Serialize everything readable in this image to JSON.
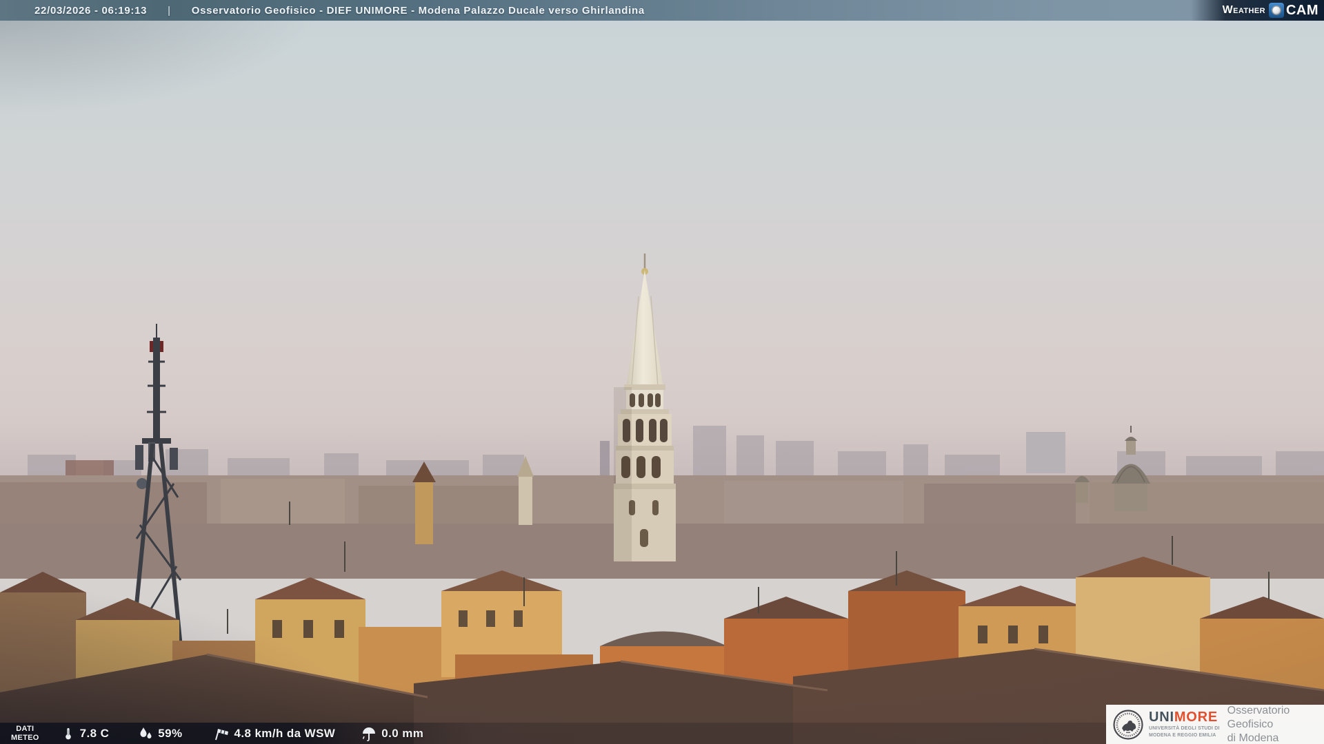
{
  "top_bar": {
    "timestamp": "22/03/2026 - 06:19:13",
    "separator": "|",
    "title": "Osservatorio Geofisico - DIEF UNIMORE - Modena Palazzo Ducale verso Ghirlandina",
    "weathercam": {
      "prefix": "Weather",
      "cam": "CAM"
    }
  },
  "bottom_bar": {
    "label_line1": "DATI",
    "label_line2": "METEO",
    "temperature": "7.8 C",
    "humidity": "59%",
    "wind": "4.8 km/h da WSW",
    "rain": "0.0 mm"
  },
  "logo_box": {
    "brand_uni": "UNI",
    "brand_more": "MORE",
    "subtitle_line1": "UNIVERSITÀ DEGLI STUDI DI",
    "subtitle_line2": "MODENA E REGGIO EMILIA",
    "org_line1": "Osservatorio Geofisico",
    "org_line2": "di Modena"
  },
  "scene": {
    "description": "Dawn webcam view over the rooftops of Modena: Ghirlandina tower in the centre, telecom lattice mast on the left, church dome on the right, hazy pink-grey sky.",
    "colors": {
      "sky_top": "#c9d4d8",
      "sky_haze_pink": "#d8cfcc",
      "horizon_haze": "#c9bdbf",
      "tower_stone": "#e6dfcc",
      "rooftop_terracotta": "#7a5340",
      "mast_silhouette": "#3b3e45",
      "topbar_left": "#4e6875",
      "topbar_right": "#8197a8",
      "weathercam_navy": "#16293e",
      "unimore_red": "#e2502e"
    }
  }
}
